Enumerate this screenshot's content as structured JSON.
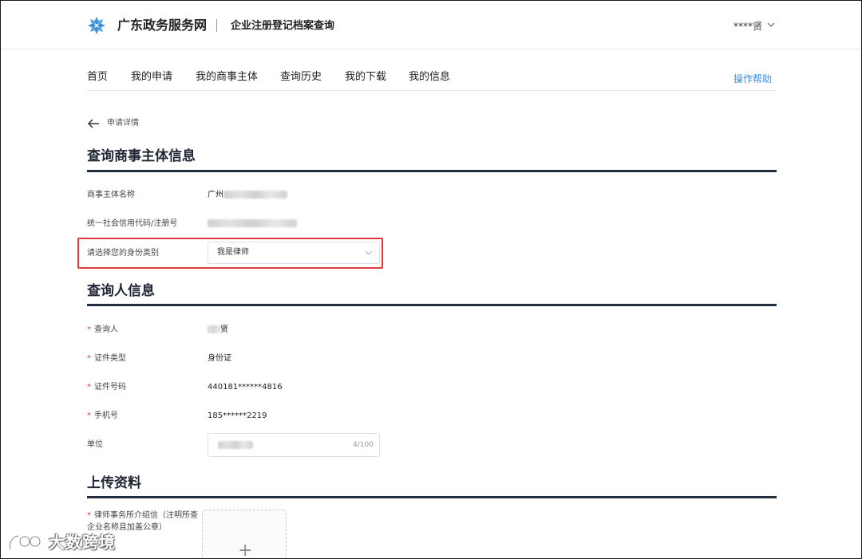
{
  "header": {
    "site_name": "广东政务服务网",
    "sub_name": "企业注册登记档案查询",
    "user_name": "****贤"
  },
  "nav": {
    "items": [
      "首页",
      "我的申请",
      "我的商事主体",
      "查询历史",
      "我的下载",
      "我的信息"
    ],
    "help": "操作帮助"
  },
  "back": {
    "label": "申请详情"
  },
  "section1": {
    "title": "查询商事主体信息",
    "entity_name_label": "商事主体名称",
    "entity_name_value": "广州",
    "credit_code_label": "统一社会信用代码/注册号",
    "identity_label": "请选择您的身份类别",
    "identity_value": "我是律师"
  },
  "section2": {
    "title": "查询人信息",
    "inquirer_label": "查询人",
    "inquirer_value": "贤",
    "id_type_label": "证件类型",
    "id_type_value": "身份证",
    "id_number_label": "证件号码",
    "id_number_value": "440181******4816",
    "phone_label": "手机号",
    "phone_value": "185******2219",
    "unit_label": "单位",
    "unit_count": "4/100"
  },
  "section3": {
    "title": "上传资料",
    "upload_label": "律师事务所介绍信（注明所查企业名称且加盖公章）",
    "upload_plus": "+"
  },
  "watermark": {
    "text": "大数跨境"
  },
  "colors": {
    "accent": "#3a8ee6",
    "required": "#e4393c",
    "highlight": "#e0393e",
    "rule": "#1f2d3d"
  }
}
